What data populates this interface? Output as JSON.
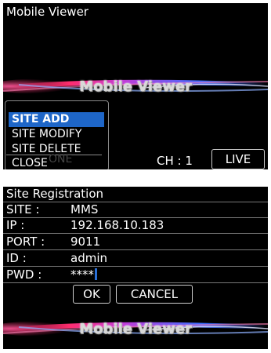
{
  "top_screen": {
    "app_title": "Mobile Viewer",
    "banner_text": "Mobile Viewer",
    "menu": {
      "items": [
        "SITE ADD",
        "SITE MODIFY",
        "SITE DELETE",
        "CLOSE"
      ],
      "selected": "SITE ADD",
      "ghost_text": "ONE"
    },
    "channel_label": "CH : 1",
    "live_label": "LIVE"
  },
  "bottom_screen": {
    "title": "Site Registration",
    "fields": [
      {
        "label": "SITE :",
        "value": "MMS"
      },
      {
        "label": "IP :",
        "value": "192.168.10.183"
      },
      {
        "label": "PORT :",
        "value": "9011"
      },
      {
        "label": "ID :",
        "value": "admin"
      },
      {
        "label": "PWD :",
        "value": "****"
      }
    ],
    "ok_label": "OK",
    "cancel_label": "CANCEL",
    "banner_text": "Mobile Viewer"
  },
  "colors": {
    "background": "#000000",
    "menu_selected": "#1e66c8",
    "banner_left": "#ff2d6e",
    "banner_right": "#3b6cff",
    "cursor": "#2a6fd6"
  }
}
